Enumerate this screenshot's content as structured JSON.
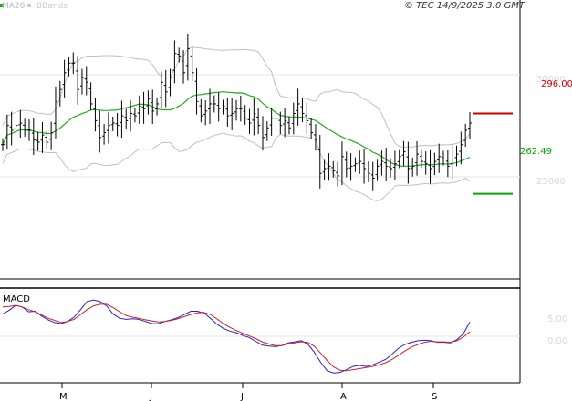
{
  "copyright": "© TEC 14/9/2025 3:0 GMT",
  "legend": {
    "ma": {
      "label": "MA20",
      "color": "#22aa22"
    },
    "bbands": {
      "label": "BBands",
      "color": "#bbbbbb"
    }
  },
  "macd_label": "MACD",
  "chart_data": [
    {
      "type": "ohlc",
      "ylim": [
        227,
        338
      ],
      "y_ticks": [
        "30000",
        "25000"
      ],
      "x_ticks": [
        "M",
        "J",
        "J",
        "A",
        "S"
      ],
      "resistance": {
        "value": 296.0,
        "label": "296.00",
        "color": "#cc0000"
      },
      "support": {
        "value": 262.49,
        "label": "262.49",
        "color": "#00aa00"
      },
      "series": [
        {
          "values": [
            283,
            291,
            289,
            291,
            292,
            289,
            289,
            285,
            284,
            287,
            284,
            288,
            301,
            306,
            313,
            317,
            317,
            306,
            311,
            309,
            300,
            293,
            286,
            288,
            291,
            292,
            291,
            295,
            293,
            296,
            295,
            299,
            298,
            302,
            297,
            300,
            309,
            305,
            311,
            321,
            320,
            313,
            323,
            313,
            301,
            295,
            297,
            300,
            300,
            298,
            299,
            295,
            296,
            298,
            298,
            294,
            292,
            296,
            291,
            286,
            290,
            294,
            294,
            291,
            293,
            290,
            296,
            300,
            296,
            293,
            288,
            285,
            271,
            273,
            274,
            272,
            270,
            278,
            273,
            274,
            275,
            276,
            273,
            271,
            269,
            274,
            276,
            274,
            273,
            275,
            278,
            280,
            273,
            274,
            279,
            276,
            275,
            273,
            276,
            278,
            277,
            274,
            277,
            279,
            283,
            289,
            292
          ]
        }
      ]
    },
    {
      "type": "line",
      "title": "MACD",
      "ylim": [
        -9.5,
        7.5
      ],
      "y_ticks": [
        "5.00",
        "0.00"
      ],
      "series": [
        {
          "values": [
            3.0,
            3.7,
            4.6,
            4.3,
            3.4,
            3.5,
            2.6,
            1.9,
            1.4,
            1.2,
            1.6,
            2.4,
            3.8,
            5.3,
            5.6,
            5.3,
            4.5,
            3.0,
            2.2,
            2.0,
            2.1,
            2.0,
            1.6,
            1.2,
            1.2,
            1.6,
            1.9,
            2.3,
            2.9,
            3.5,
            3.5,
            3.2,
            2.2,
            1.1,
            0.3,
            -0.2,
            -0.5,
            -1.0,
            -1.4,
            -2.1,
            -2.8,
            -3.0,
            -3.1,
            -2.9,
            -2.4,
            -2.2,
            -2.0,
            -2.6,
            -4.1,
            -6.0,
            -7.6,
            -8.0,
            -7.9,
            -7.4,
            -6.8,
            -6.6,
            -6.8,
            -6.5,
            -6.0,
            -5.5,
            -4.5,
            -3.4,
            -2.7,
            -2.3,
            -2.0,
            -1.9,
            -2.0,
            -2.3,
            -2.3,
            -2.4,
            -1.8,
            -0.7,
            1.5
          ]
        },
        {
          "values": [
            4.3,
            4.4,
            4.6,
            4.3,
            3.8,
            3.4,
            2.8,
            2.2,
            1.8,
            1.4,
            1.6,
            2.0,
            2.9,
            3.8,
            4.5,
            4.8,
            4.8,
            4.2,
            3.4,
            2.7,
            2.4,
            2.2,
            1.9,
            1.7,
            1.5,
            1.6,
            1.8,
            2.1,
            2.5,
            2.9,
            3.2,
            3.3,
            2.9,
            2.1,
            1.2,
            0.5,
            -0.1,
            -0.6,
            -1.1,
            -1.6,
            -2.2,
            -2.6,
            -2.9,
            -2.9,
            -2.6,
            -2.4,
            -2.2,
            -2.3,
            -3.0,
            -4.3,
            -5.7,
            -6.9,
            -7.5,
            -7.6,
            -7.4,
            -7.2,
            -7.0,
            -6.8,
            -6.5,
            -6.1,
            -5.5,
            -4.7,
            -3.9,
            -3.2,
            -2.7,
            -2.3,
            -2.1,
            -2.2,
            -2.2,
            -2.3,
            -2.0,
            -1.3,
            -0.3
          ]
        }
      ]
    }
  ]
}
